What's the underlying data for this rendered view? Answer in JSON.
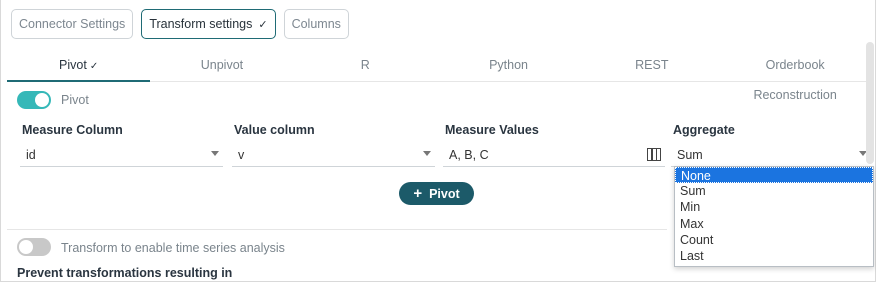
{
  "steps": [
    {
      "label": "Connector Settings",
      "active": false
    },
    {
      "label": "Transform settings",
      "active": true,
      "check": "✓"
    },
    {
      "label": "Columns",
      "active": false
    }
  ],
  "tabs": [
    {
      "label": "Pivot",
      "active": true,
      "check": "✓"
    },
    {
      "label": "Unpivot"
    },
    {
      "label": "R"
    },
    {
      "label": "Python"
    },
    {
      "label": "REST"
    },
    {
      "label": "Orderbook Reconstruction"
    }
  ],
  "pivot_toggle": {
    "label": "Pivot",
    "on": true
  },
  "columns": {
    "measure_column": {
      "header": "Measure Column",
      "value": "id"
    },
    "value_column": {
      "header": "Value column",
      "value": "v"
    },
    "measure_values": {
      "header": "Measure Values",
      "value": "A, B, C"
    },
    "aggregate": {
      "header": "Aggregate",
      "value": "Sum"
    }
  },
  "pivot_button": {
    "icon": "+",
    "label": "Pivot"
  },
  "time_series_toggle": {
    "label": "Transform to enable time series analysis",
    "on": false
  },
  "prevent_label": "Prevent transformations resulting in",
  "aggregate_options": [
    "None",
    "Sum",
    "Min",
    "Max",
    "Count",
    "Last"
  ],
  "aggregate_highlighted": "None",
  "colors": {
    "accent": "#1f6b75",
    "toggle_on": "#35b8b8",
    "button": "#1c5a69",
    "highlight": "#1b74e0"
  }
}
